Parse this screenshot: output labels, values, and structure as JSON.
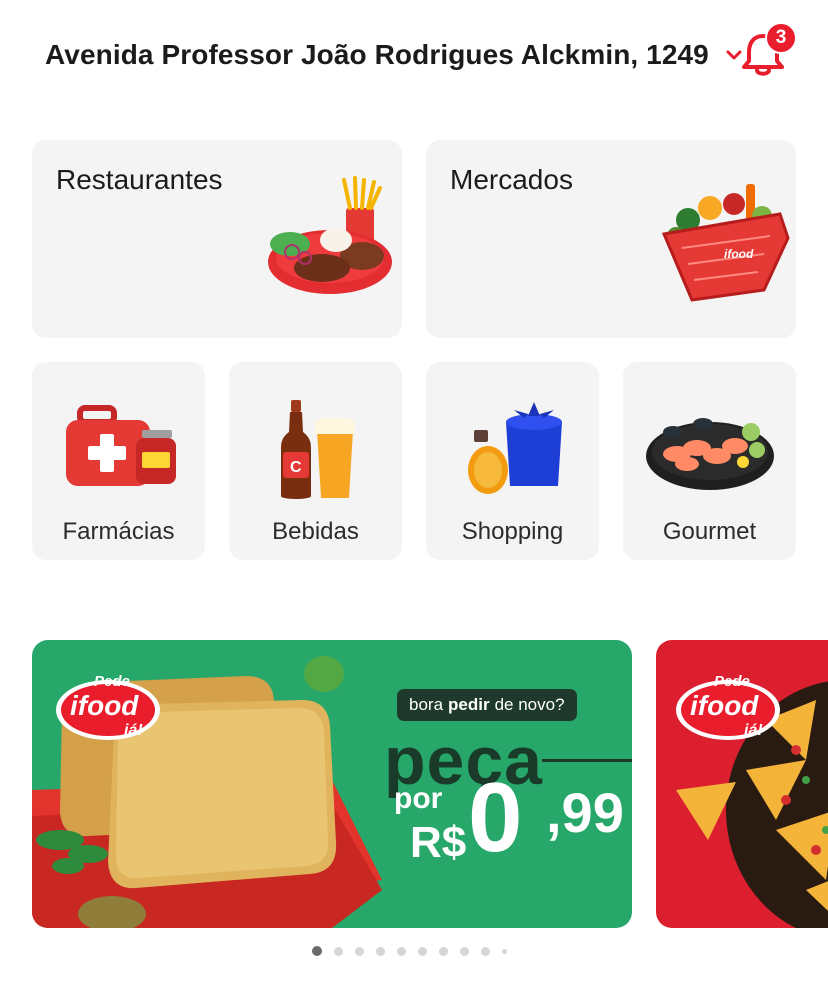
{
  "header": {
    "address": "Avenida Professor João Rodrigues Alckmin, 1249",
    "notification_count": "3"
  },
  "categories": {
    "large": [
      {
        "label": "Restaurantes",
        "icon": "restaurant-plate-icon"
      },
      {
        "label": "Mercados",
        "icon": "grocery-basket-icon"
      }
    ],
    "small": [
      {
        "label": "Farmácias",
        "icon": "first-aid-kit-icon"
      },
      {
        "label": "Bebidas",
        "icon": "beer-bottle-icon"
      },
      {
        "label": "Shopping",
        "icon": "gift-box-icon"
      },
      {
        "label": "Gourmet",
        "icon": "seafood-plate-icon"
      }
    ]
  },
  "banners": [
    {
      "logo_top": "Pede",
      "logo_main": "ifood",
      "logo_bottom": "já!",
      "pill_prefix": "bora",
      "pill_bold": "pedir",
      "pill_suffix": "de novo?",
      "headline": "peça",
      "por": "por",
      "currency": "R$",
      "price": "0",
      "cents": ",99"
    },
    {
      "logo_top": "Pede",
      "logo_main": "ifood",
      "logo_bottom": "já!"
    }
  ],
  "carousel": {
    "total_dots": 10,
    "active_index": 0
  },
  "colors": {
    "brand_red": "#ea1d2c",
    "promo_green": "#27a86a",
    "card_bg": "#f4f4f4"
  }
}
